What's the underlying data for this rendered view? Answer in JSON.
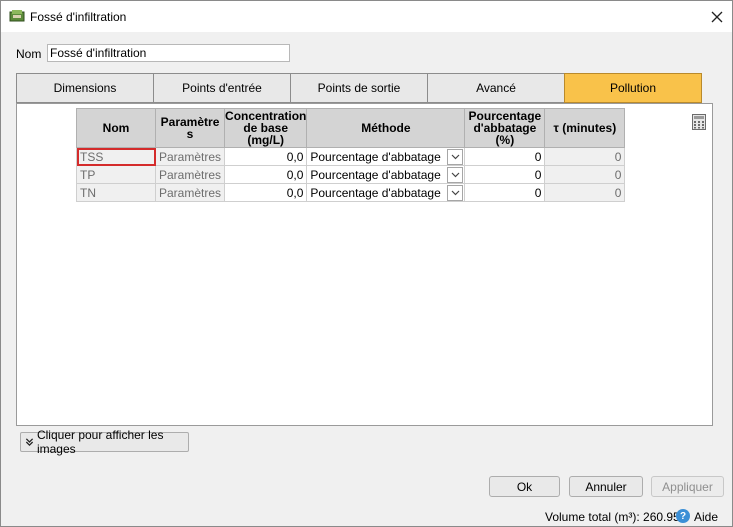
{
  "window": {
    "title": "Fossé d'infiltration"
  },
  "name_field": {
    "label": "Nom",
    "value": "Fossé d'infiltration"
  },
  "tabs": [
    {
      "label": "Dimensions",
      "active": false
    },
    {
      "label": "Points d'entrée",
      "active": false
    },
    {
      "label": "Points de sortie",
      "active": false
    },
    {
      "label": "Avancé",
      "active": false
    },
    {
      "label": "Pollution",
      "active": true
    }
  ],
  "table": {
    "headers": {
      "nom": "Nom",
      "parametres": "Paramètre s",
      "concentration": "Concentration de base (mg/L)",
      "methode": "Méthode",
      "pourcentage": "Pourcentage d'abbatage (%)",
      "tau": "τ (minutes)"
    },
    "rows": [
      {
        "nom": "TSS",
        "parametres": "Paramètres",
        "concentration": "0,0",
        "methode": "Pourcentage d'abbatage",
        "pourcentage": "0",
        "tau": "0"
      },
      {
        "nom": "TP",
        "parametres": "Paramètres",
        "concentration": "0,0",
        "methode": "Pourcentage d'abbatage",
        "pourcentage": "0",
        "tau": "0"
      },
      {
        "nom": "TN",
        "parametres": "Paramètres",
        "concentration": "0,0",
        "methode": "Pourcentage d'abbatage",
        "pourcentage": "0",
        "tau": "0"
      }
    ]
  },
  "images_button": {
    "label": "Cliquer pour afficher les images"
  },
  "buttons": {
    "ok": "Ok",
    "cancel": "Annuler",
    "apply": "Appliquer"
  },
  "status": {
    "volume": "Volume total (m³): 260.959",
    "help": "Aide"
  },
  "colors": {
    "active_tab": "#f9c24a",
    "selected_cell_border": "#d42b2b",
    "header_bg": "#d4d4d4"
  }
}
